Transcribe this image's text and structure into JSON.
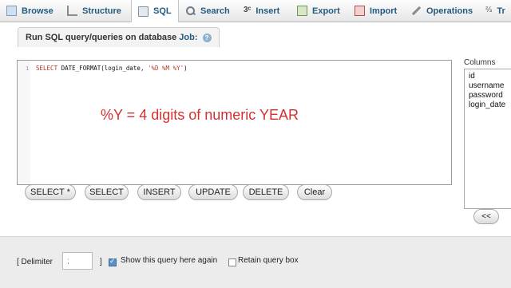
{
  "tabs": [
    {
      "label": "Browse",
      "icon": "table-icon"
    },
    {
      "label": "Structure",
      "icon": "structure-icon"
    },
    {
      "label": "SQL",
      "icon": "sql-icon"
    },
    {
      "label": "Search",
      "icon": "search-icon"
    },
    {
      "label": "Insert",
      "icon": "insert-icon"
    },
    {
      "label": "Export",
      "icon": "export-icon"
    },
    {
      "label": "Import",
      "icon": "import-icon"
    },
    {
      "label": "Operations",
      "icon": "operations-icon"
    },
    {
      "label": "Tr",
      "icon": "triggers-icon"
    }
  ],
  "active_tab": "SQL",
  "query_panel": {
    "legend_prefix": "Run SQL query/queries on database",
    "database": "Job:",
    "help_glyph": "?"
  },
  "editor": {
    "line_number": "1",
    "code_keyword": "SELECT",
    "code_rest": "DATE_FORMAT(login_date, ",
    "code_string": "'%D %M %Y'",
    "code_tail": ")"
  },
  "overlay_text": "%Y = 4 digits of numeric YEAR",
  "buttons": {
    "select_star": "SELECT *",
    "select": "SELECT",
    "insert": "INSERT",
    "update": "UPDATE",
    "delete": "DELETE",
    "clear": "Clear"
  },
  "columns": {
    "label": "Columns",
    "items": [
      "id",
      "username",
      "password",
      "login_date"
    ],
    "insert_button": "<<"
  },
  "options": {
    "delimiter_label": "[ Delimiter",
    "delimiter_value": ";",
    "delimiter_close": "]",
    "show_query_label": "Show this query here again",
    "show_query_checked": true,
    "retain_label": "Retain query box",
    "retain_checked": false
  },
  "colors": {
    "link": "#235a81",
    "overlay": "#d43030",
    "keyword": "#b03a2e"
  }
}
